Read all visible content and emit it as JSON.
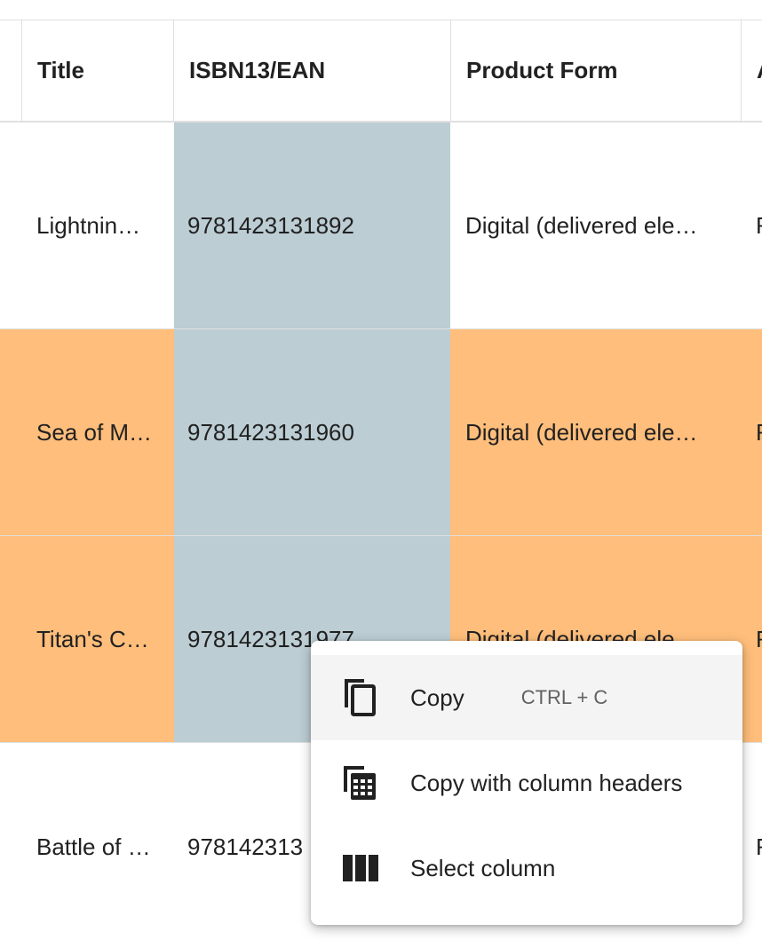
{
  "columns": [
    {
      "key": "title",
      "label": "Title"
    },
    {
      "key": "isbn",
      "label": "ISBN13/EAN"
    },
    {
      "key": "form",
      "label": "Product Form"
    },
    {
      "key": "next",
      "label": "A"
    }
  ],
  "rows": [
    {
      "title": "Lightnin…",
      "isbn": "9781423131892",
      "form": "Digital (delivered ele…",
      "next": "R",
      "highlighted": false
    },
    {
      "title": "Sea of M…",
      "isbn": "9781423131960",
      "form": "Digital (delivered ele…",
      "next": "R",
      "highlighted": true
    },
    {
      "title": "Titan's C…",
      "isbn": "9781423131977",
      "form": "Digital (delivered ele…",
      "next": "R",
      "highlighted": true
    },
    {
      "title": "Battle of …",
      "isbn": "978142313",
      "form": "",
      "next": "R",
      "highlighted": false
    }
  ],
  "context_menu": {
    "items": [
      {
        "label": "Copy",
        "shortcut": "CTRL + C",
        "icon": "copy-icon",
        "active": true
      },
      {
        "label": "Copy with column headers",
        "shortcut": "",
        "icon": "copy-table-icon",
        "active": false
      },
      {
        "label": "Select column",
        "shortcut": "",
        "icon": "column-icon",
        "active": false
      }
    ]
  },
  "colors": {
    "row_highlight": "#ffbe7b",
    "selected_column": "#bccdd4",
    "border": "#e0e0e0",
    "menu_active": "#f4f4f4"
  }
}
